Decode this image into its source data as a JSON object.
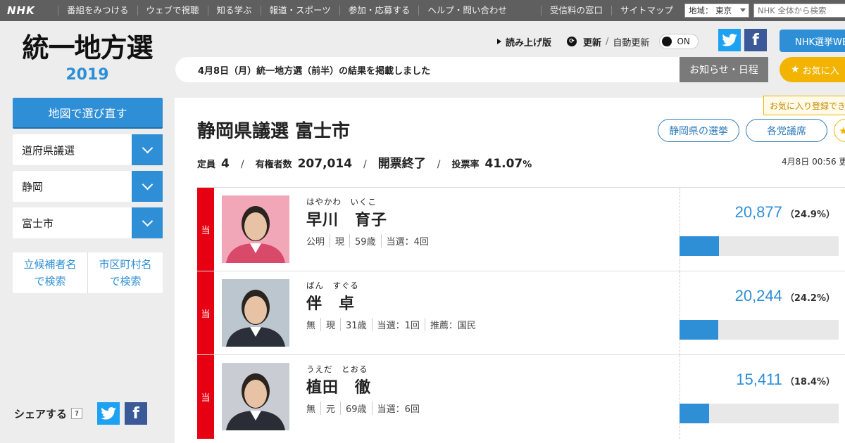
{
  "topbar": {
    "logo": "NHK",
    "nav": [
      "番組をみつける",
      "ウェブで視聴",
      "知る学ぶ",
      "報道・スポーツ",
      "参加・応募する",
      "ヘルプ・問い合わせ"
    ],
    "reception": "受信料の窓口",
    "sitemap": "サイトマップ",
    "region": "地域： 東京",
    "search_placeholder": "NHK 全体から検索"
  },
  "site": {
    "title": "統一地方選",
    "year": "2019"
  },
  "controls": {
    "read_aloud": "読み上げ版",
    "refresh": "更新",
    "auto_refresh": "自動更新",
    "toggle_state": "ON",
    "nhk_election_web": "NHK選挙WE"
  },
  "notice": {
    "text": "4月8日（月）統一地方選（前半）の結果を掲載しました",
    "news_button": "お知らせ・日程",
    "favorite_button": "お気に入"
  },
  "sidebar": {
    "map_button": "地図で選び直す",
    "selects": [
      {
        "value": "道府県議選"
      },
      {
        "value": "静岡"
      },
      {
        "value": "富士市"
      }
    ],
    "search_candidate": [
      "立候補者名",
      "で検索"
    ],
    "search_city": [
      "市区町村名",
      "で検索"
    ],
    "share_label": "シェアする",
    "help_mark": "?"
  },
  "race": {
    "title": "静岡県議選 富士市",
    "pill_pref": "静岡県の選挙",
    "pill_party": "各党議席",
    "tooltip": "お気に入り登録でき",
    "stats": {
      "seats_label": "定員",
      "seats": "4",
      "voters_label": "有権者数",
      "voters": "207,014",
      "status": "開票終了",
      "turnout_label": "投票率",
      "turnout": "41.07",
      "turnout_unit": "%"
    },
    "updated": "4月8日 00:56 更"
  },
  "candidates": [
    {
      "elected_mark": "当",
      "kana": "はやかわ　いくこ",
      "name": "早川　育子",
      "attrs": [
        "公明",
        "現",
        "59歳",
        "当選：4回"
      ],
      "votes": "20,877",
      "share": "（24.9%）",
      "share_value": 24.9,
      "photo_bg": "#f2a7b8",
      "photo_suit": "#d94a6a"
    },
    {
      "elected_mark": "当",
      "kana": "ばん　すぐる",
      "name": "伴　卓",
      "attrs": [
        "無",
        "現",
        "31歳",
        "当選：1回",
        "推薦：国民"
      ],
      "votes": "20,244",
      "share": "（24.2%）",
      "share_value": 24.2,
      "photo_bg": "#bcc6cf",
      "photo_suit": "#2b2f3a"
    },
    {
      "elected_mark": "当",
      "kana": "うえだ　とおる",
      "name": "植田　徹",
      "attrs": [
        "無",
        "元",
        "69歳",
        "当選：6回"
      ],
      "votes": "15,411",
      "share": "（18.4%）",
      "share_value": 18.4,
      "photo_bg": "#c9cdd3",
      "photo_suit": "#2a2d35"
    }
  ]
}
